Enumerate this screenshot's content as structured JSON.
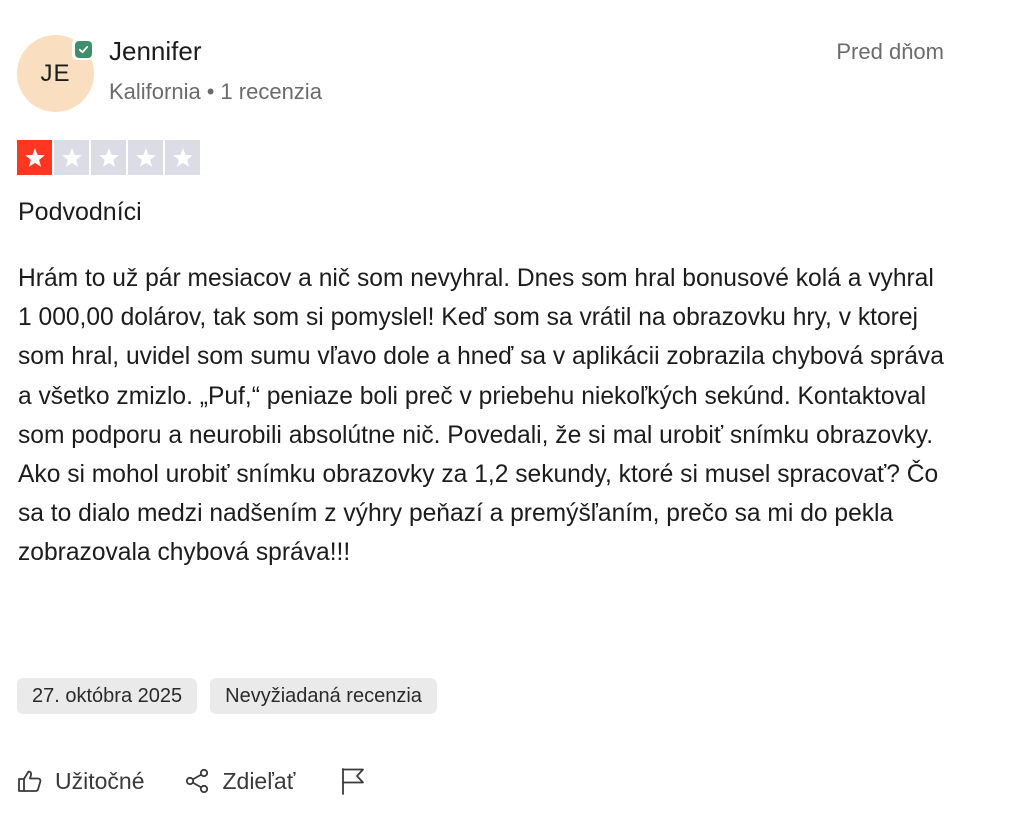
{
  "reviewer": {
    "initials": "JE",
    "name": "Jennifer",
    "location": "Kalifornia",
    "separator": "•",
    "review_count": "1 recenzia",
    "verified_color": "#3e8f6a",
    "avatar_color": "#f9dfbf"
  },
  "review": {
    "relative_date": "Pred dňom",
    "rating": 1,
    "rating_max": 5,
    "star_color": "#ff3722",
    "title": "Podvodníci",
    "body": "Hrám to už pár mesiacov a nič som nevyhral. Dnes som hral bonusové kolá a vyhral 1 000,00 dolárov, tak som si pomyslel! Keď som sa vrátil na obrazovku hry, v ktorej som hral, uvidel som sumu vľavo dole a hneď sa v aplikácii zobrazila chybová správa a všetko zmizlo. „Puf,“ peniaze boli preč v priebehu niekoľkých sekúnd. Kontaktoval som podporu a neurobili absolútne nič. Povedali, že si mal urobiť snímku obrazovky. Ako si mohol urobiť snímku obrazovky za 1,2 sekundy, ktoré si musel spracovať? Čo sa to dialo medzi nadšením z výhry peňazí a premýšľaním, prečo sa mi do pekla zobrazovala chybová správa!!!",
    "tags": {
      "date": "27. októbra 2025",
      "type": "Nevyžiadaná recenzia"
    }
  },
  "actions": {
    "useful_label": "Užitočné",
    "useful_icon": "thumbs-up-icon",
    "share_label": "Zdieľať",
    "share_icon": "share-icon",
    "report_icon": "flag-icon"
  }
}
